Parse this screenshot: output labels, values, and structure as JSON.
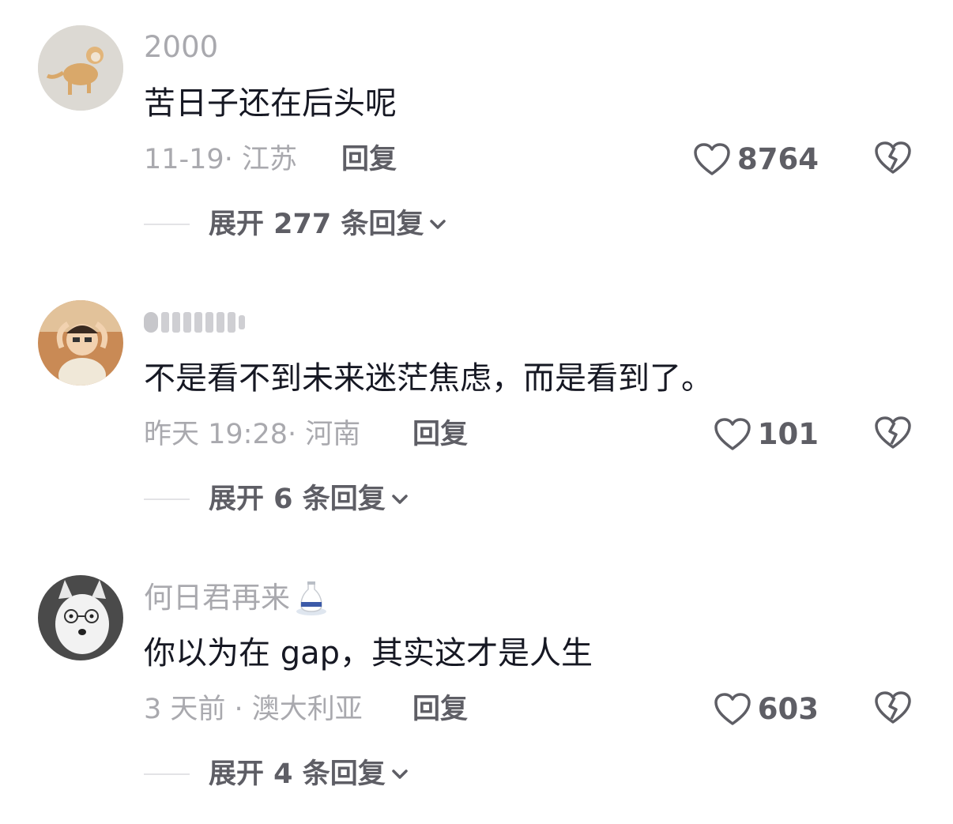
{
  "comments": [
    {
      "username": "2000",
      "text": "苦日子还在后头呢",
      "meta": "11-19· 江苏",
      "reply_label": "回复",
      "likes": "8764",
      "expand_label": "展开 277 条回复"
    },
    {
      "username": "",
      "text": "不是看不到未来迷茫焦虑，而是看到了。",
      "meta": "昨天 19:28· 河南",
      "reply_label": "回复",
      "likes": "101",
      "expand_label": "展开 6 条回复"
    },
    {
      "username": "何日君再来",
      "text": "你以为在 gap，其实这才是人生",
      "meta": "3 天前 · 澳大利亚",
      "reply_label": "回复",
      "likes": "603",
      "expand_label": "展开 4 条回复"
    }
  ],
  "colors": {
    "text_primary": "#161823",
    "text_secondary": "#a9a9ae",
    "text_action": "#5e5e65"
  },
  "icons": [
    "heart-outline-icon",
    "broken-heart-icon",
    "chevron-down-icon",
    "sake-bottle-icon"
  ]
}
